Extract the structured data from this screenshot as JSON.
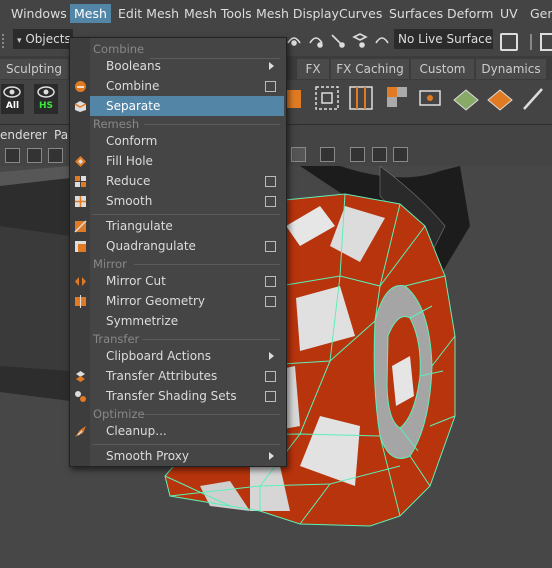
{
  "menubar": {
    "items": [
      "Windows",
      "Mesh",
      "Edit Mesh",
      "Mesh Tools",
      "Mesh Display",
      "Curves",
      "Surfaces",
      "Deform",
      "UV",
      "Gene"
    ],
    "active": "Mesh"
  },
  "statusline": {
    "selection_mode": "Objects",
    "live_surface": "No Live Surface"
  },
  "shelf_tabs": [
    "Sculpting",
    "FX",
    "FX Caching",
    "Custom",
    "Dynamics"
  ],
  "shelf": {
    "all_label": "All",
    "hs_label": "HS"
  },
  "panel_menu": {
    "renderer": "enderer",
    "panels": "Pa"
  },
  "mesh_menu": {
    "sections": {
      "combine": "Combine",
      "remesh": "Remesh",
      "mirror": "Mirror",
      "transfer": "Transfer",
      "optimize": "Optimize"
    },
    "items": {
      "booleans": "Booleans",
      "combine": "Combine",
      "separate": "Separate",
      "conform": "Conform",
      "fill_hole": "Fill Hole",
      "reduce": "Reduce",
      "smooth": "Smooth",
      "triangulate": "Triangulate",
      "quadrangulate": "Quadrangulate",
      "mirror_cut": "Mirror Cut",
      "mirror_geometry": "Mirror Geometry",
      "symmetrize": "Symmetrize",
      "clipboard_actions": "Clipboard Actions",
      "transfer_attributes": "Transfer Attributes",
      "transfer_shading_sets": "Transfer Shading Sets",
      "cleanup": "Cleanup...",
      "smooth_proxy": "Smooth Proxy"
    },
    "highlighted": "Separate"
  },
  "colors": {
    "menu_highlight": "#5285a6",
    "wire_green": "#5cf0b8",
    "tire_red": "#b8340c",
    "hs_green": "#3ae83a"
  }
}
